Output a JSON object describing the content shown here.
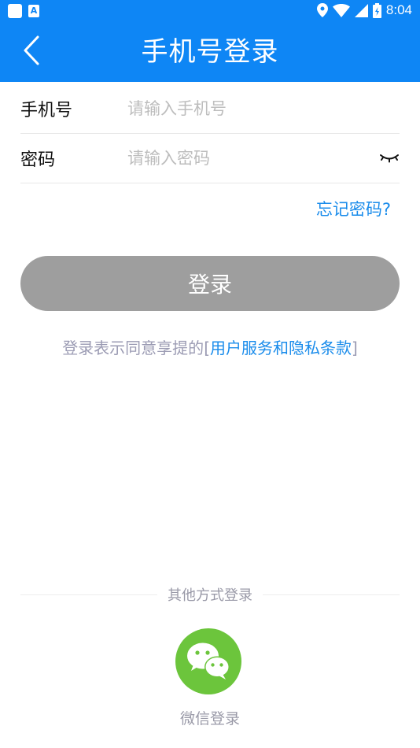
{
  "status_bar": {
    "app_icon_text": "A",
    "time": "8:04"
  },
  "app_bar": {
    "title": "手机号登录",
    "back_icon": "chevron-left-icon"
  },
  "form": {
    "phone_label": "手机号",
    "phone_placeholder": "请输入手机号",
    "password_label": "密码",
    "password_placeholder": "请输入密码",
    "eye_icon": "eye-closed-icon"
  },
  "forgot_password": "忘记密码?",
  "login_button": "登录",
  "agreement": {
    "prefix": "登录表示同意享提的",
    "bracket_open": "[",
    "link": "用户服务和隐私条款",
    "bracket_close": "]"
  },
  "other_login": {
    "label": "其他方式登录",
    "wechat_label": "微信登录",
    "wechat_icon": "wechat-icon"
  },
  "colors": {
    "primary": "#0e86f5",
    "link": "#1a8ceb",
    "button_disabled": "#9e9e9e",
    "wechat_green": "#6cc53c"
  }
}
